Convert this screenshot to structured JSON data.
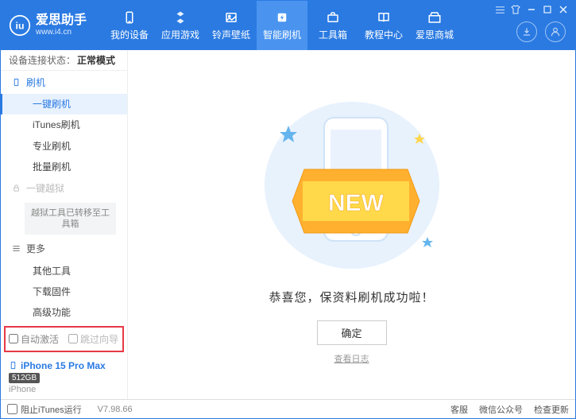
{
  "logo": {
    "title": "爱思助手",
    "sub": "www.i4.cn"
  },
  "nav": [
    {
      "label": "我的设备"
    },
    {
      "label": "应用游戏"
    },
    {
      "label": "铃声壁纸"
    },
    {
      "label": "智能刷机",
      "active": true
    },
    {
      "label": "工具箱"
    },
    {
      "label": "教程中心"
    },
    {
      "label": "爱思商城"
    }
  ],
  "status": {
    "label": "设备连接状态：",
    "value": "正常模式"
  },
  "sidebar": {
    "section_flash": "刷机",
    "items_flash": [
      "一键刷机",
      "iTunes刷机",
      "专业刷机",
      "批量刷机"
    ],
    "section_jb": "一键越狱",
    "jb_note": "越狱工具已转移至工具箱",
    "section_more": "更多",
    "items_more": [
      "其他工具",
      "下载固件",
      "高级功能"
    ],
    "cb_auto": "自动激活",
    "cb_skip": "跳过向导",
    "device_name": "iPhone 15 Pro Max",
    "device_storage": "512GB",
    "device_type": "iPhone"
  },
  "main": {
    "new_badge": "NEW",
    "success_msg": "恭喜您，保资料刷机成功啦！",
    "ok_btn": "确定",
    "view_log": "查看日志"
  },
  "footer": {
    "block_itunes": "阻止iTunes运行",
    "version": "V7.98.66",
    "links": [
      "客服",
      "微信公众号",
      "检查更新"
    ]
  }
}
